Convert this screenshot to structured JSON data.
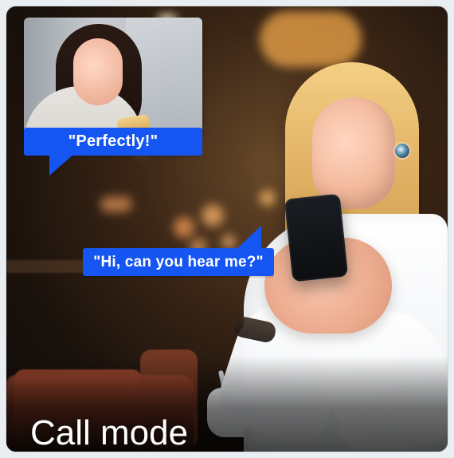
{
  "image": {
    "caption": "Call mode"
  },
  "bubbles": {
    "top": "\"Perfectly!\"",
    "middle": "\"Hi, can you hear me?\""
  },
  "colors": {
    "bubble_blue": "#1556f2",
    "caption_text": "#ffffff"
  }
}
